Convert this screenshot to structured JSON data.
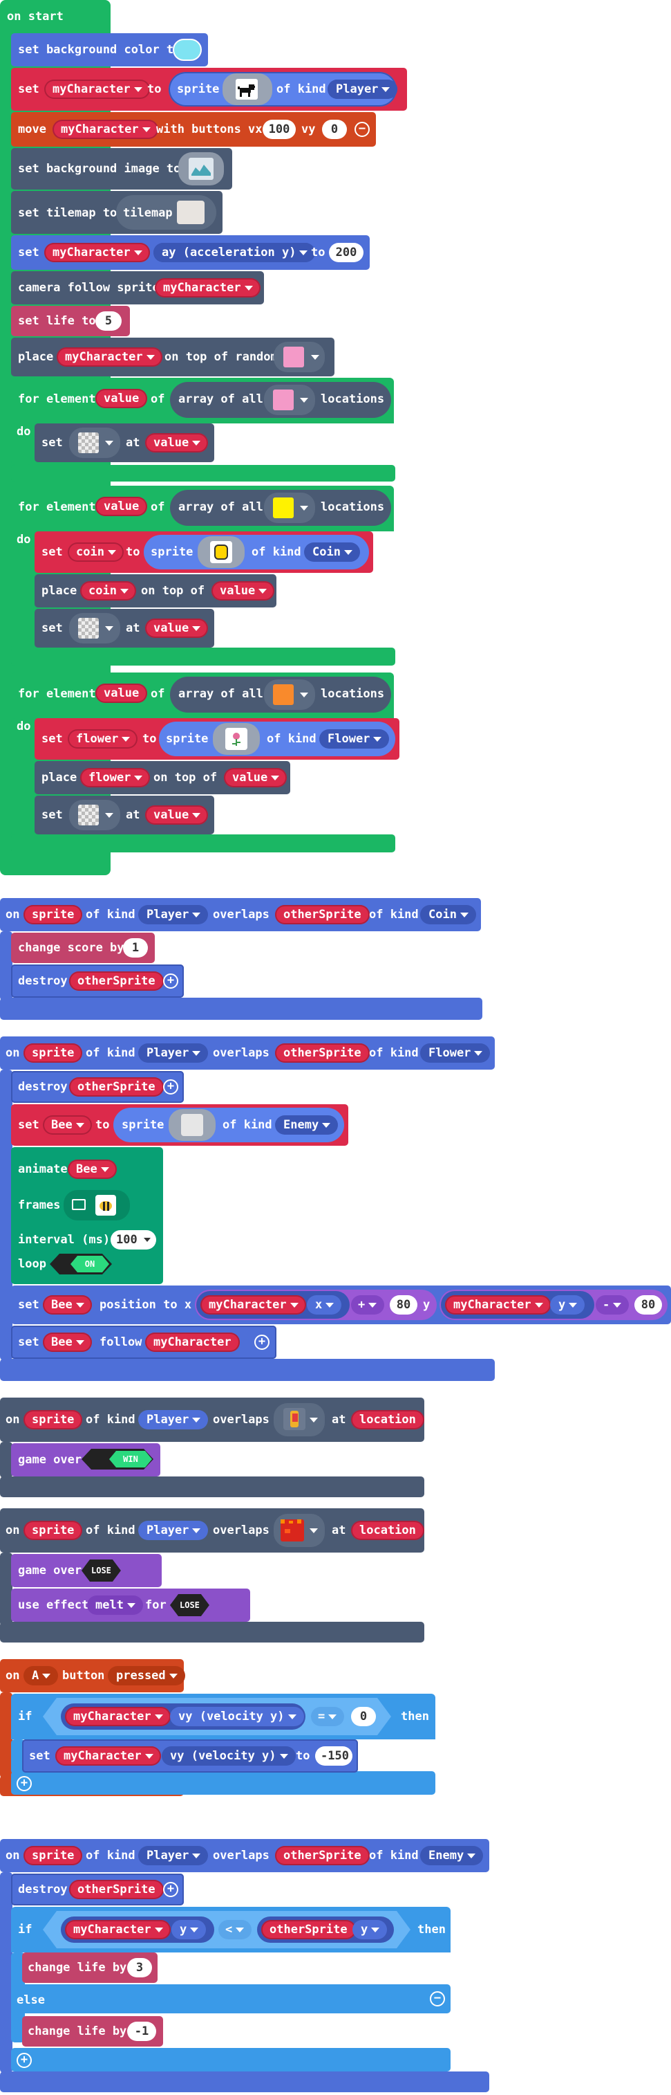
{
  "blocks": {
    "on_start": {
      "hat": "on start",
      "set_bg_color": {
        "label": "set background color to",
        "color": "#7fe3f2"
      },
      "set_mychar": {
        "set": "set",
        "var": "myCharacter",
        "to": "to",
        "sprite": "sprite",
        "of_kind": "of kind",
        "kind": "Player"
      },
      "move": {
        "label": "move",
        "var": "myCharacter",
        "with": "with buttons vx",
        "vx": "100",
        "vy_label": "vy",
        "vy": "0"
      },
      "set_bg_image": {
        "label": "set background image to"
      },
      "set_tilemap": {
        "label": "set tilemap to",
        "tilemap": "tilemap"
      },
      "set_ay": {
        "set": "set",
        "var": "myCharacter",
        "prop": "ay (acceleration y)",
        "to": "to",
        "value": "200"
      },
      "camera": {
        "label": "camera follow sprite",
        "var": "myCharacter"
      },
      "set_life": {
        "label": "set life to",
        "value": "5"
      },
      "place": {
        "label": "place",
        "var": "myCharacter",
        "on_top": "on top of random",
        "color": "#f49ac8"
      },
      "loop1": {
        "for": "for element",
        "var": "value",
        "of": "of",
        "array": "array of all",
        "locations": "locations",
        "do": "do",
        "color": "#f49ac8",
        "set": "set",
        "at": "at",
        "at_var": "value"
      },
      "loop2": {
        "for": "for element",
        "var": "value",
        "of": "of",
        "array": "array of all",
        "locations": "locations",
        "do": "do",
        "color": "#fff200",
        "set_coin": {
          "set": "set",
          "var": "coin",
          "to": "to",
          "sprite": "sprite",
          "of_kind": "of kind",
          "kind": "Coin"
        },
        "place": {
          "label": "place",
          "var": "coin",
          "on_top": "on top of",
          "target": "value"
        },
        "set": "set",
        "at": "at",
        "at_var": "value"
      },
      "loop3": {
        "for": "for element",
        "var": "value",
        "of": "of",
        "array": "array of all",
        "locations": "locations",
        "do": "do",
        "color": "#f98a2c",
        "set_flower": {
          "set": "set",
          "var": "flower",
          "to": "to",
          "sprite": "sprite",
          "of_kind": "of kind",
          "kind": "Flower"
        },
        "place": {
          "label": "place",
          "var": "flower",
          "on_top": "on top of",
          "target": "value"
        },
        "set": "set",
        "at": "at",
        "at_var": "value"
      }
    },
    "overlap_coin": {
      "on": "on",
      "sprite": "sprite",
      "of_kind": "of kind",
      "kind": "Player",
      "overlaps": "overlaps",
      "other": "otherSprite",
      "of_kind2": "of kind",
      "kind2": "Coin",
      "change_score": "change score by",
      "score": "1",
      "destroy": "destroy",
      "destroy_var": "otherSprite"
    },
    "overlap_flower": {
      "on": "on",
      "sprite": "sprite",
      "of_kind": "of kind",
      "kind": "Player",
      "overlaps": "overlaps",
      "other": "otherSprite",
      "of_kind2": "of kind",
      "kind2": "Flower",
      "destroy": "destroy",
      "destroy_var": "otherSprite",
      "set_bee": {
        "set": "set",
        "var": "Bee",
        "to": "to",
        "sprite": "sprite",
        "of_kind": "of kind",
        "kind": "Enemy"
      },
      "animate": {
        "label": "animate",
        "var": "Bee",
        "frames": "frames",
        "interval": "interval (ms)",
        "interval_val": "100",
        "loop": "loop",
        "loop_val": "ON"
      },
      "set_pos": {
        "set": "set",
        "var": "Bee",
        "pos": "position to x",
        "x_var": "myCharacter",
        "x_prop": "x",
        "op1": "+",
        "v1": "80",
        "y": "y",
        "y_var": "myCharacter",
        "y_prop": "y",
        "op2": "-",
        "v2": "80"
      },
      "follow": {
        "set": "set",
        "var": "Bee",
        "follow": "follow",
        "target": "myCharacter"
      }
    },
    "overlap_win": {
      "on": "on",
      "sprite": "sprite",
      "of_kind": "of kind",
      "kind": "Player",
      "overlaps": "overlaps",
      "at": "at",
      "loc": "location",
      "game_over": "game over",
      "result": "WIN"
    },
    "overlap_lose": {
      "on": "on",
      "sprite": "sprite",
      "of_kind": "of kind",
      "kind": "Player",
      "overlaps": "overlaps",
      "at": "at",
      "loc": "location",
      "game_over": "game over",
      "result": "LOSE",
      "use_effect": "use effect",
      "effect": "melt",
      "for": "for",
      "for_val": "LOSE"
    },
    "on_a": {
      "on": "on",
      "button": "A",
      "label": "button",
      "event": "pressed",
      "if": "if",
      "var": "myCharacter",
      "prop": "vy (velocity y)",
      "op": "=",
      "value": "0",
      "then": "then",
      "set": "set",
      "set_var": "myCharacter",
      "set_prop": "vy (velocity y)",
      "to": "to",
      "set_val": "-150"
    },
    "overlap_enemy": {
      "on": "on",
      "sprite": "sprite",
      "of_kind": "of kind",
      "kind": "Player",
      "overlaps": "overlaps",
      "other": "otherSprite",
      "of_kind2": "of kind",
      "kind2": "Enemy",
      "destroy": "destroy",
      "destroy_var": "otherSprite",
      "if": "if",
      "var": "myCharacter",
      "prop": "y",
      "op": "<",
      "other_var": "otherSprite",
      "other_prop": "y",
      "then": "then",
      "change_life1": "change life by",
      "life1": "3",
      "else": "else",
      "change_life2": "change life by",
      "life2": "-1"
    }
  },
  "colors": {
    "scene_blue": "#4e6fd8",
    "sprites_red": "#dc2a4b",
    "info_pink": "#c2436b",
    "loops_green": "#1bb764",
    "game_slate": "#4a5a73",
    "logic_light_blue": "#3a9ae8",
    "controller_orange": "#d2461f",
    "animation_green": "#08a074",
    "effects_purple": "#8b51c9"
  }
}
